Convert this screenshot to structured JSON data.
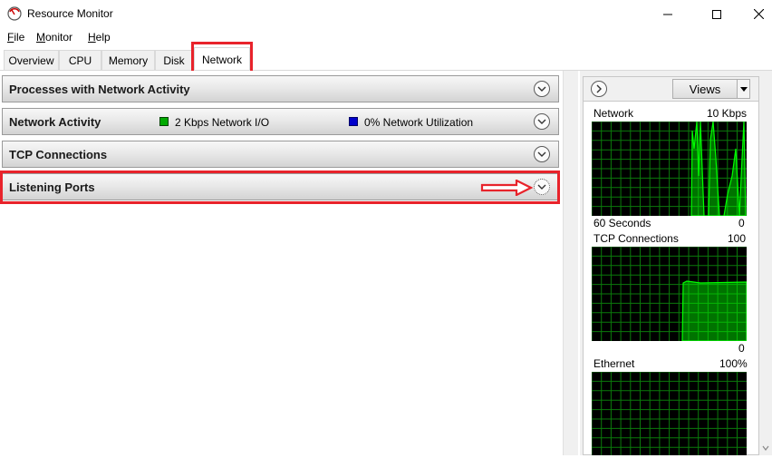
{
  "window": {
    "title": "Resource Monitor",
    "minimize": "minimize",
    "maximize": "maximize",
    "close": "close"
  },
  "menu": {
    "file": "File",
    "monitor": "Monitor",
    "help": "Help"
  },
  "tabs": [
    "Overview",
    "CPU",
    "Memory",
    "Disk",
    "Network"
  ],
  "active_tab": "Network",
  "sections": {
    "processes": "Processes with Network Activity",
    "network_activity": "Network Activity",
    "network_io": "2 Kbps Network I/O",
    "network_util": "0% Network Utilization",
    "tcp": "TCP Connections",
    "listening": "Listening Ports"
  },
  "right_panel": {
    "views_label": "Views",
    "network": {
      "label": "Network",
      "max": "10 Kbps",
      "time": "60 Seconds",
      "min": "0"
    },
    "tcp": {
      "label": "TCP Connections",
      "max": "100",
      "min": "0"
    },
    "ethernet": {
      "label": "Ethernet",
      "max": "100%"
    }
  },
  "colors": {
    "highlight": "#e8232b",
    "graph_green": "#00ff00",
    "io_legend": "#00aa00",
    "util_legend": "#0000cc"
  }
}
